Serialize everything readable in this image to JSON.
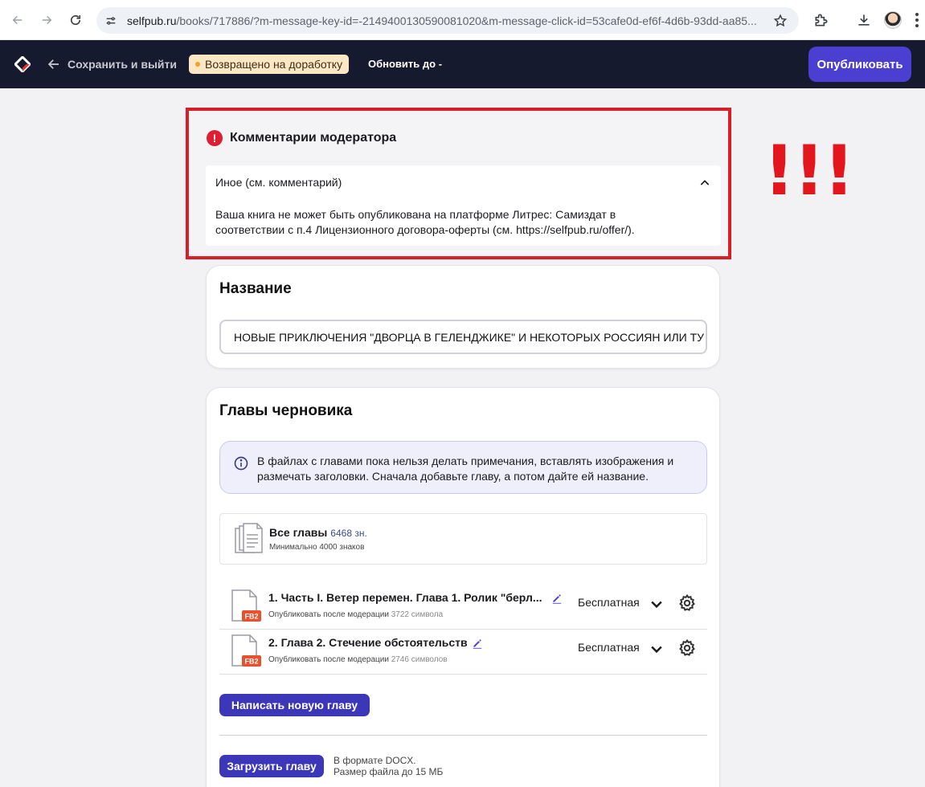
{
  "browser": {
    "url_host": "selfpub.ru",
    "url_rest": "/books/717886/?m-message-key-id=-2149400130590081020&m-message-click-id=53cafe0d-ef6f-4d6b-93dd-aa85...",
    "icons": [
      "back-arrow-icon",
      "forward-arrow-icon",
      "reload-icon",
      "site-settings-icon",
      "bookmark-star-icon",
      "extensions-icon",
      "download-icon",
      "profile-avatar",
      "menu-icon"
    ]
  },
  "header": {
    "save_exit_label": "Сохранить и выйти",
    "status_label": "Возвращено на доработку",
    "update_label": "Обновить до -",
    "publish_label": "Опубликовать",
    "colors": {
      "background": "#161a2e",
      "accent": "#4b3fd1",
      "status_bg": "#fbe7c4"
    }
  },
  "moderator": {
    "title": "Комментарии модератора",
    "reason": "Иное (см. комментарий)",
    "comment_line1": "Ваша книга не может быть опубликована на платформе Литрес: Самиздат в",
    "comment_line2": "соответствии с п.4 Лицензионного договора-оферты (см. https://selfpub.ru/offer/).",
    "highlight_color": "#d61f26"
  },
  "annotation": {
    "exclamation": "!!!"
  },
  "title_section": {
    "heading": "Название",
    "value": "НОВЫЕ ПРИКЛЮЧЕНИЯ \"ДВОРЦА В ГЕЛЕНДЖИКЕ\" И НЕКОТОРЫХ РОССИЯН ИЛИ ТУ"
  },
  "chapters_section": {
    "heading": "Главы черновика",
    "info_line1": "В файлах с главами пока нельзя делать примечания, вставлять изображения и",
    "info_line2": "размечать заголовки. Сначала добавьте главу, а потом дайте ей название.",
    "all_chapters": {
      "label": "Все главы",
      "count": "6468 зн.",
      "minimum": "Минимально 4000 знаков"
    },
    "chapters": [
      {
        "title": "1. Часть I. Ветер перемен. Глава 1. Ролик \"берл...",
        "status": "Опубликовать после модерации",
        "chars": "3722 символа",
        "price": "Бесплатная",
        "file_badge": "FB2"
      },
      {
        "title": "2. Глава 2. Стечение обстоятельств",
        "status": "Опубликовать после модерации",
        "chars": "2746 символов",
        "price": "Бесплатная",
        "file_badge": "FB2"
      }
    ],
    "write_new_label": "Написать новую главу",
    "upload_label": "Загрузить главу",
    "upload_note_line1": "В формате DOCX.",
    "upload_note_line2": "Размер файла до 15 МБ"
  }
}
